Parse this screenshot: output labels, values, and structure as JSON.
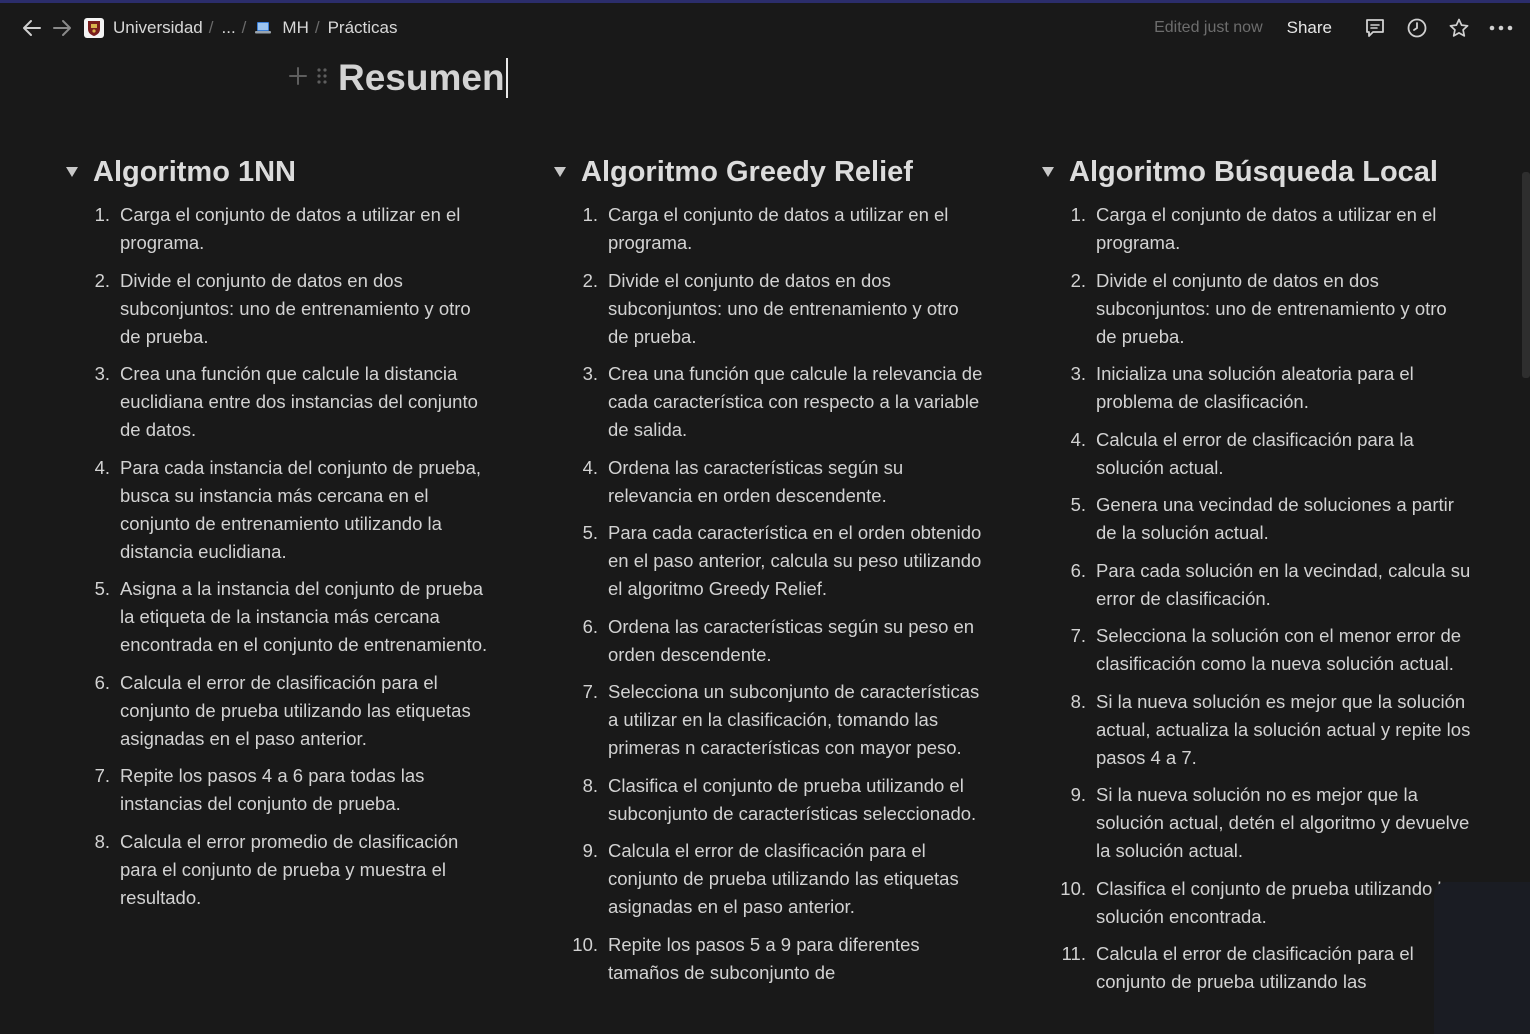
{
  "breadcrumb": {
    "workspace": "Universidad",
    "ellipsis": "...",
    "parent": "MH",
    "current": "Prácticas",
    "separator": "/"
  },
  "header": {
    "edited_status": "Edited just now",
    "share_label": "Share"
  },
  "page": {
    "title": "Resumen"
  },
  "columns": [
    {
      "heading": "Algoritmo 1NN",
      "steps": [
        {
          "n": "1.",
          "text": "Carga el conjunto de datos a utilizar en el programa."
        },
        {
          "n": "2.",
          "text": "Divide el conjunto de datos en dos subconjuntos: uno de entrenamiento y otro de prueba."
        },
        {
          "n": "3.",
          "text": "Crea una función que calcule la distancia euclidiana entre dos instancias del conjunto de datos."
        },
        {
          "n": "4.",
          "text": "Para cada instancia del conjunto de prueba, busca su instancia más cercana en el conjunto de entrenamiento utilizando la distancia euclidiana."
        },
        {
          "n": "5.",
          "text": "Asigna a la instancia del conjunto de prueba la etiqueta de la instancia más cercana encontrada en el conjunto de entrenamiento."
        },
        {
          "n": "6.",
          "text": "Calcula el error de clasificación para el conjunto de prueba utilizando las etiquetas asignadas en el paso anterior."
        },
        {
          "n": "7.",
          "text": "Repite los pasos 4 a 6 para todas las instancias del conjunto de prueba."
        },
        {
          "n": "8.",
          "text": "Calcula el error promedio de clasificación para el conjunto de prueba y muestra el resultado."
        }
      ]
    },
    {
      "heading": "Algoritmo Greedy Relief",
      "steps": [
        {
          "n": "1.",
          "text": "Carga el conjunto de datos a utilizar en el programa."
        },
        {
          "n": "2.",
          "text": "Divide el conjunto de datos en dos subconjuntos: uno de entrenamiento y otro de prueba."
        },
        {
          "n": "3.",
          "text": "Crea una función que calcule la relevancia de cada característica con respecto a la variable de salida."
        },
        {
          "n": "4.",
          "text": "Ordena las características según su relevancia en orden descendente."
        },
        {
          "n": "5.",
          "text": "Para cada característica en el orden obtenido en el paso anterior, calcula su peso utilizando el algoritmo Greedy Relief."
        },
        {
          "n": "6.",
          "text": "Ordena las características según su peso en orden descendente."
        },
        {
          "n": "7.",
          "text": "Selecciona un subconjunto de características a utilizar en la clasificación, tomando las primeras n características con mayor peso."
        },
        {
          "n": "8.",
          "text": "Clasifica el conjunto de prueba utilizando el subconjunto de características seleccionado."
        },
        {
          "n": "9.",
          "text": "Calcula el error de clasificación para el conjunto de prueba utilizando las etiquetas asignadas en el paso anterior."
        },
        {
          "n": "10.",
          "text": "Repite los pasos 5 a 9 para diferentes tamaños de subconjunto de"
        }
      ]
    },
    {
      "heading": "Algoritmo Búsqueda Local",
      "steps": [
        {
          "n": "1.",
          "text": "Carga el conjunto de datos a utilizar en el programa."
        },
        {
          "n": "2.",
          "text": "Divide el conjunto de datos en dos subconjuntos: uno de entrenamiento y otro de prueba."
        },
        {
          "n": "3.",
          "text": "Inicializa una solución aleatoria para el problema de clasificación."
        },
        {
          "n": "4.",
          "text": "Calcula el error de clasificación para la solución actual."
        },
        {
          "n": "5.",
          "text": "Genera una vecindad de soluciones a partir de la solución actual."
        },
        {
          "n": "6.",
          "text": "Para cada solución en la vecindad, calcula su error de clasificación."
        },
        {
          "n": "7.",
          "text": "Selecciona la solución con el menor error de clasificación como la nueva solución actual."
        },
        {
          "n": "8.",
          "text": "Si la nueva solución es mejor que la solución actual, actualiza la solución actual y repite los pasos 4 a 7."
        },
        {
          "n": "9.",
          "text": "Si la nueva solución no es mejor que la solución actual, detén el algoritmo y devuelve la solución actual."
        },
        {
          "n": "10.",
          "text": "Clasifica el conjunto de prueba utilizando la solución encontrada."
        },
        {
          "n": "11.",
          "text": "Calcula el error de clasificación para el conjunto de prueba utilizando las"
        }
      ]
    }
  ],
  "icons": {
    "back": "arrow-left-icon",
    "forward": "arrow-right-icon",
    "workspace": "university-crest-icon",
    "parent": "laptop-icon",
    "comments": "comment-icon",
    "history": "clock-icon",
    "favorite": "star-icon",
    "more": "more-horizontal-icon",
    "add": "plus-icon",
    "drag": "drag-handle-icon",
    "toggle": "toggle-triangle-icon"
  }
}
